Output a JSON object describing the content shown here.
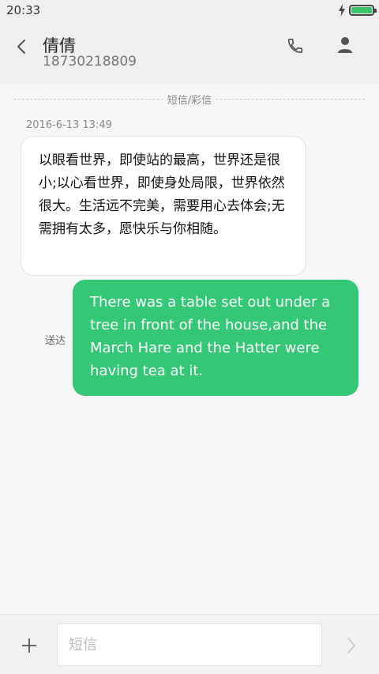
{
  "status_bar": {
    "time": "20:33",
    "battery_level": 1.0
  },
  "header": {
    "contact_name": "倩倩",
    "contact_number": "18730218809"
  },
  "conversation": {
    "channel_label": "短信/彩信",
    "timestamp": "2016-6-13 13:49",
    "incoming_message": "以眼看世界，即使站的最高，世界还是很小;以心看世界，即使身处局限，世界依然很大。生活远不完美，需要用心去体会;无需拥有太多，愿快乐与你相随。",
    "outgoing_status": "送达",
    "outgoing_message": "There was a table set out under a tree in front of the house,and the March Hare and the Hatter were having tea at it."
  },
  "composer": {
    "placeholder": "短信"
  },
  "icons": {
    "back": "chevron-left-icon",
    "call": "phone-icon",
    "contact": "person-icon",
    "add": "plus-icon",
    "send": "chevron-right-icon",
    "charging": "bolt-icon",
    "battery": "battery-icon"
  },
  "colors": {
    "accent_green": "#34c776",
    "battery_green": "#3cc46b",
    "background": "#f7f7f7",
    "header_bg": "#efefef"
  }
}
